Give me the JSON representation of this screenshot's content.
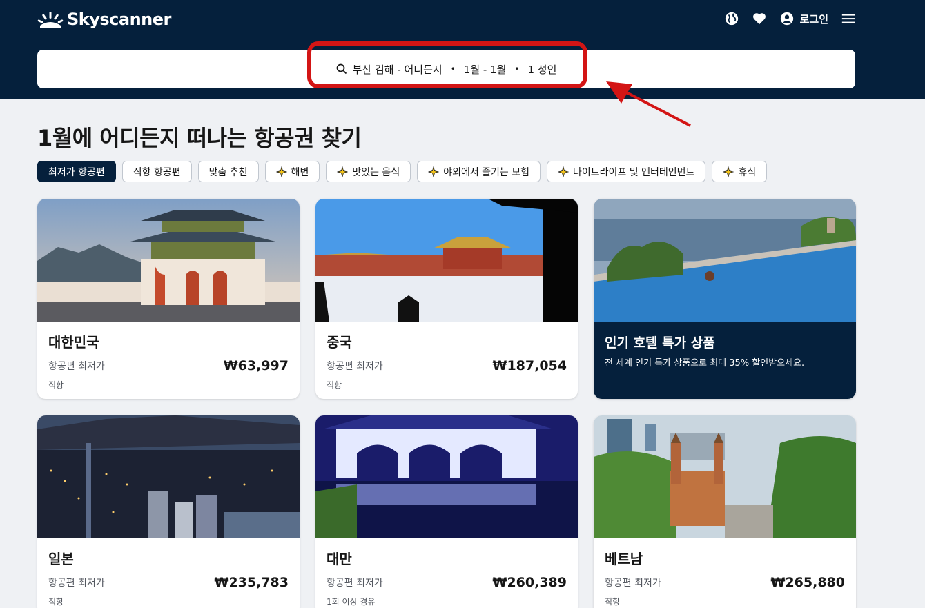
{
  "header": {
    "logo_text": "Skyscanner",
    "login_label": "로그인"
  },
  "search": {
    "origin_destination": "부산 김해 - 어디든지",
    "dates": "1월 - 1월",
    "travelers": "1 성인"
  },
  "main": {
    "title": "1월에 어디든지 떠나는 항공권 찾기",
    "chips": [
      {
        "label": "최저가 항공편",
        "active": true
      },
      {
        "label": "직항 항공편"
      },
      {
        "label": "맞춤 추천"
      },
      {
        "label": "해변"
      },
      {
        "label": "맛있는 음식"
      },
      {
        "label": "야외에서 즐기는 모험"
      },
      {
        "label": "나이트라이프 및 엔터테인먼트"
      },
      {
        "label": "휴식"
      }
    ],
    "cards": [
      {
        "country": "대한민국",
        "label": "항공편 최저가",
        "price": "₩63,997",
        "sub": "직항"
      },
      {
        "country": "중국",
        "label": "항공편 최저가",
        "price": "₩187,054",
        "sub": "직항"
      },
      {
        "promo_title": "인기 호텔 특가 상품",
        "promo_sub": "전 세계 인기 특가 상품으로 최대 35% 할인받으세요."
      },
      {
        "country": "일본",
        "label": "항공편 최저가",
        "price": "₩235,783",
        "sub": "직항"
      },
      {
        "country": "대만",
        "label": "항공편 최저가",
        "price": "₩260,389",
        "sub": "1회 이상 경유"
      },
      {
        "country": "베트남",
        "label": "항공편 최저가",
        "price": "₩265,880",
        "sub": "직항"
      }
    ]
  },
  "colors": {
    "header_bg": "#05203c",
    "highlight": "#d31515",
    "page_bg": "#eff1f4"
  },
  "icons": [
    "skyscanner-logo-icon",
    "globe-icon",
    "heart-icon",
    "account-icon",
    "menu-icon",
    "search-icon",
    "sparkle-icon"
  ]
}
